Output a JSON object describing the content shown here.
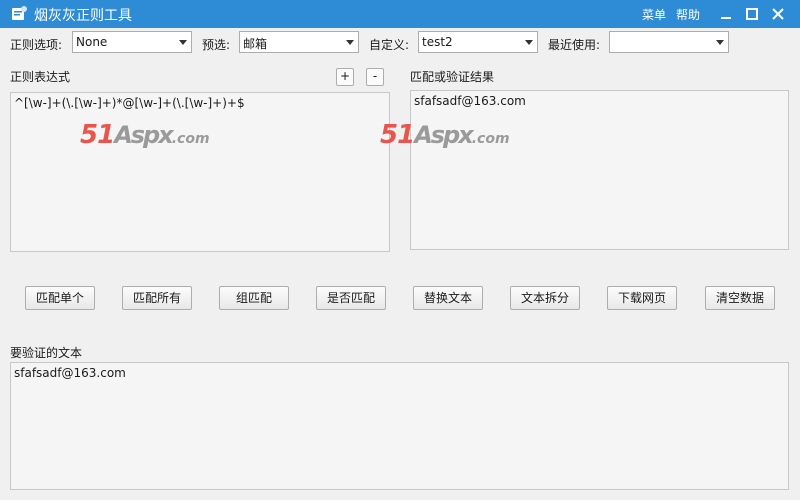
{
  "window": {
    "title": "烟灰灰正则工具",
    "menu_label": "菜单",
    "help_label": "帮助",
    "title_bar_color": "#2e8bd6"
  },
  "toolbar": {
    "regex_option_label": "正则选项:",
    "regex_option_value": "None",
    "preset_label": "预选:",
    "preset_value": "邮箱",
    "custom_label": "自定义:",
    "custom_value": "test2",
    "recent_label": "最近使用:",
    "recent_value": ""
  },
  "regex_panel": {
    "label": "正则表达式",
    "add_label": "+",
    "remove_label": "-",
    "value": "^[\\w-]+(\\.[\\w-]+)*@[\\w-]+(\\.[\\w-]+)+$"
  },
  "result_panel": {
    "label": "匹配或验证结果",
    "value": "sfafsadf@163.com"
  },
  "actions": [
    {
      "label": "匹配单个"
    },
    {
      "label": "匹配所有"
    },
    {
      "label": "组匹配"
    },
    {
      "label": "是否匹配"
    },
    {
      "label": "替换文本"
    },
    {
      "label": "文本拆分"
    },
    {
      "label": "下载网页"
    },
    {
      "label": "清空数据"
    }
  ],
  "input_panel": {
    "label": "要验证的文本",
    "value": "sfafsadf@163.com"
  },
  "watermark": {
    "num": "51",
    "brand": "Aspx",
    "domain": ".com"
  }
}
